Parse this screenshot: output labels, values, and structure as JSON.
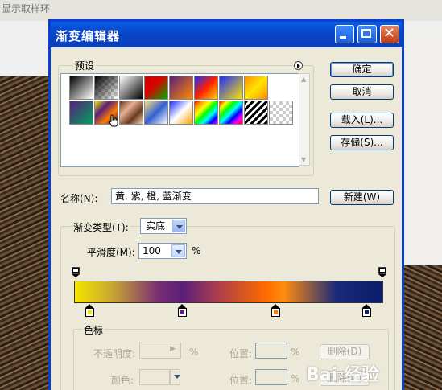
{
  "background": {
    "menu_fragment": "显示取样环"
  },
  "dialog": {
    "title": "渐变编辑器",
    "presets_label": "预设",
    "ok_label": "确定",
    "cancel_label": "取消",
    "load_label": "载入(L)...",
    "save_label": "存储(S)...",
    "name_label": "名称(N):",
    "name_value": "黄, 紫, 橙, 蓝渐变",
    "new_label": "新建(W)",
    "gradient_type_label": "渐变类型(T):",
    "gradient_type_value": "实底",
    "smoothness_label": "平滑度(M):",
    "smoothness_value": "100",
    "smoothness_unit": "%",
    "color_stops_label": "色标",
    "opacity_label": "不透明度:",
    "opacity_unit": "%",
    "position_label": "位置:",
    "position_unit": "%",
    "delete_label": "删除(D)",
    "color_label": "颜色:",
    "position2_label": "位置:",
    "position2_unit": "%",
    "delete2_label": "删除(D)"
  },
  "colors": {
    "gradient_stops": [
      "#f5e400",
      "#5a1f7a",
      "#ff7b00",
      "#0a1c6a"
    ],
    "title_bar": "#0a52e0"
  },
  "watermark": "Bai 经验"
}
